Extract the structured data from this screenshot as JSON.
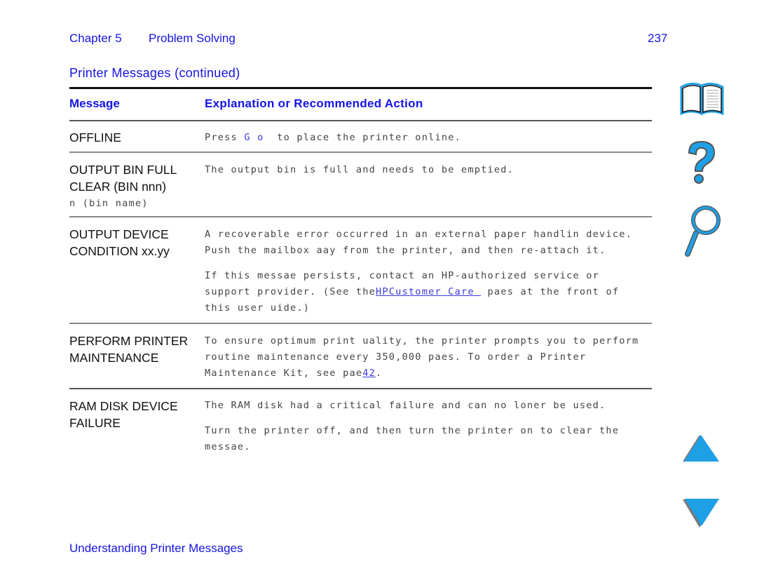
{
  "header": {
    "chapter": "Chapter 5",
    "chapter_title": "Problem Solving",
    "page_number": "237"
  },
  "section_title": "Printer Messages (continued)",
  "table": {
    "columns": [
      "Message",
      "Explanation or Recommended Action"
    ],
    "rows": [
      {
        "message_lines": [
          "OFFLINE"
        ],
        "explanation": {
          "pre": "Press ",
          "key": "G o",
          "post": "  to place the printer online."
        }
      },
      {
        "message_lines": [
          "OUTPUT BIN FULL",
          "CLEAR (BIN nnn)"
        ],
        "message_sub": "n (bin name)",
        "explanation_lines": [
          "The output bin is full and needs to be emptied."
        ]
      },
      {
        "message_lines": [
          "OUTPUT DEVICE",
          "CONDITION xx.yy"
        ],
        "explanation_lines": [
          "A recoverable error occurred in an external paper handlin device.",
          "Push the mailbox aay from the printer, and then re-attach it."
        ],
        "explanation2": {
          "line1": "If this messae persists, contact an HP-authorized service or",
          "line2_pre": "support provider. (See the",
          "line2_link": "HPCustomer Care ",
          "line2_post": " paes at the front of",
          "line3": "this user uide.)"
        }
      },
      {
        "message_lines": [
          "PERFORM PRINTER",
          "MAINTENANCE"
        ],
        "explanation": {
          "line1": "To ensure optimum print uality, the printer prompts you to perform",
          "line2": "routine maintenance every 350,000 paes. To order a Printer",
          "line3_pre": "Maintenance Kit, see pae",
          "line3_link": "42",
          "line3_post": "."
        }
      },
      {
        "message_lines": [
          "RAM DISK DEVICE",
          "FAILURE"
        ],
        "explanation_lines": [
          "The RAM disk had a critical failure and can no loner be used."
        ],
        "explanation2_lines": [
          "Turn the printer off, and then turn the printer on to clear the",
          "messae."
        ]
      }
    ]
  },
  "nav_icons": {
    "contents": "book-icon",
    "help": "question-mark-icon",
    "search": "magnifier-icon",
    "prev_page": "up-triangle-icon",
    "next_page": "down-triangle-icon"
  },
  "colors": {
    "heading_blue": "#1414e6",
    "icon_blue": "#1ea0e6"
  },
  "footer": "Understanding Printer Messages"
}
